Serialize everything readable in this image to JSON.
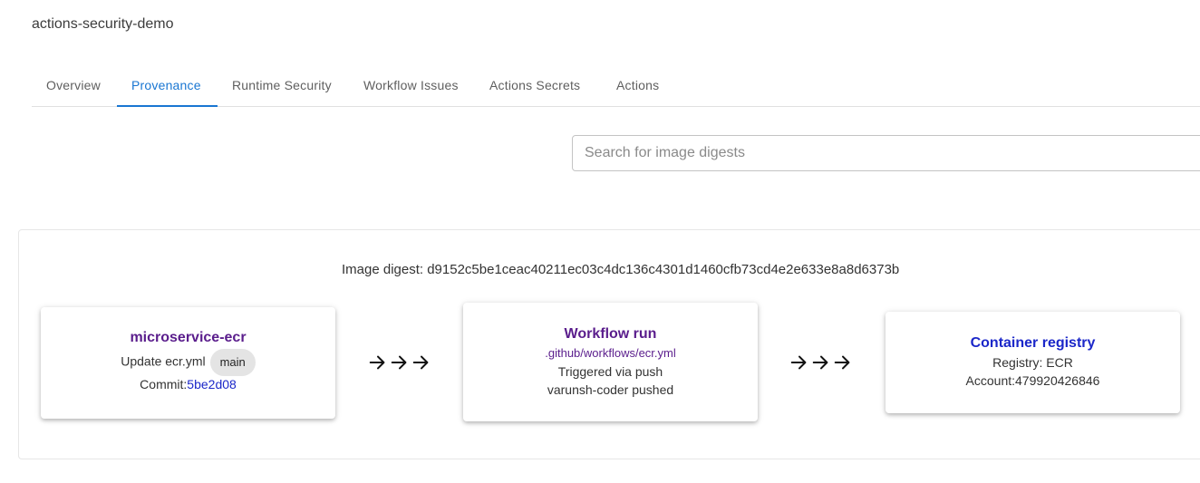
{
  "header": {
    "repo_title": "actions-security-demo"
  },
  "tabs": [
    {
      "label": "Overview",
      "active": false
    },
    {
      "label": "Provenance",
      "active": true
    },
    {
      "label": "Runtime Security",
      "active": false
    },
    {
      "label": "Workflow Issues",
      "active": false
    },
    {
      "label": "Actions Secrets",
      "active": false
    },
    {
      "label": "Actions",
      "active": false
    }
  ],
  "search": {
    "placeholder": "Search for image digests",
    "value": ""
  },
  "provenance": {
    "digest_text": "Image digest: d9152c5be1ceac40211ec03c4dc136c4301d1460cfb73cd4e2e633e8a8d6373b",
    "repo_card": {
      "title": "microservice-ecr",
      "commit_message": "Update ecr.yml",
      "branch": "main",
      "commit_label": "Commit:",
      "commit_sha": "5be2d08"
    },
    "workflow_card": {
      "title": "Workflow run",
      "workflow_path": ".github/workflows/ecr.yml",
      "trigger": "Triggered via push",
      "actor": "varunsh-coder pushed"
    },
    "registry_card": {
      "title": "Container registry",
      "registry": "Registry: ECR",
      "account": "Account:479920426846"
    }
  },
  "colors": {
    "accent": "#1976d2",
    "card_title_purple": "#5a1d8c",
    "card_title_blue": "#1b27c9",
    "chip_bg": "#e4e4e4"
  },
  "icons": {
    "flow_arrow": "arrow-right-icon"
  }
}
